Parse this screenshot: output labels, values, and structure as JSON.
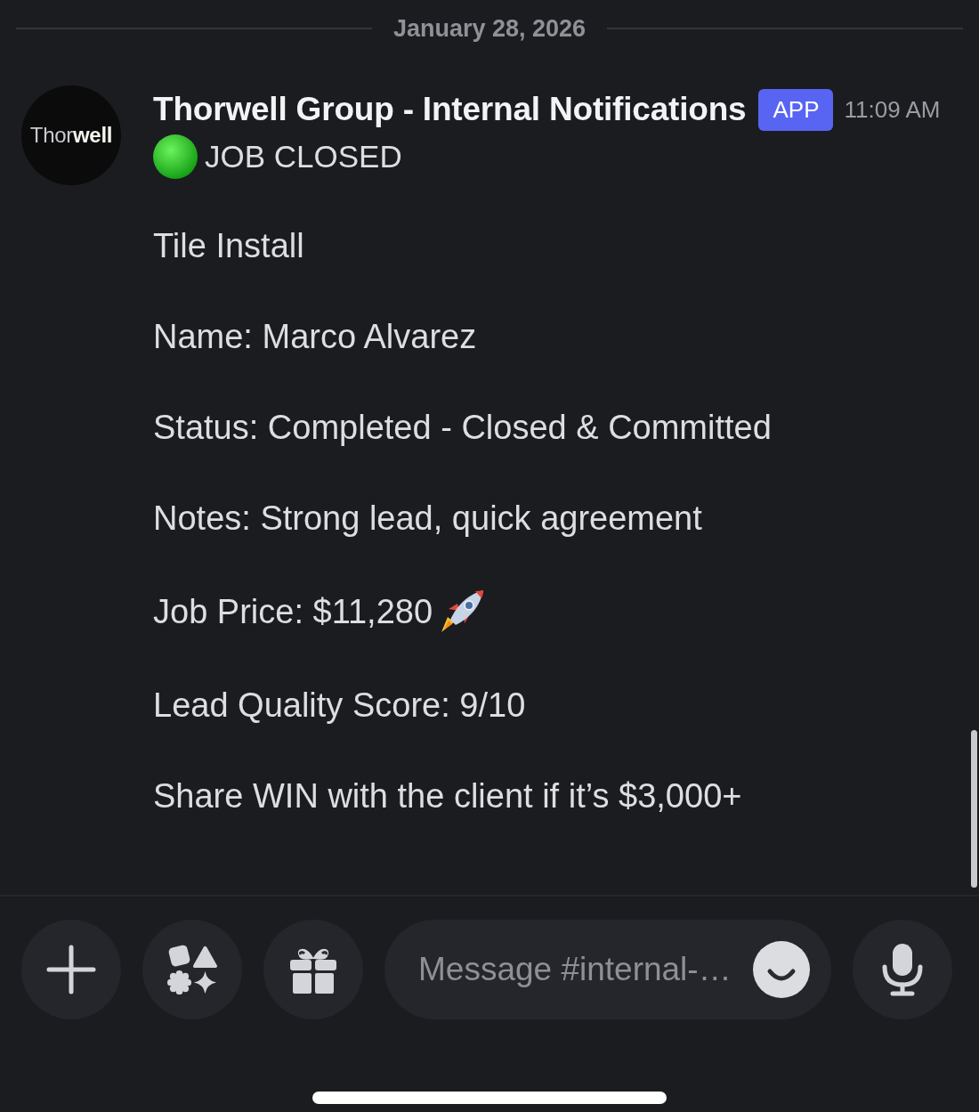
{
  "date_divider": "January 28, 2026",
  "message": {
    "avatar": {
      "logo": "Thor**well**"
    },
    "author": "Thorwell Group - Internal Notifications",
    "badge": "APP",
    "time": "11:09 AM",
    "headline": "JOB CLOSED",
    "paragraphs": [
      {
        "kind": "plain",
        "text": "Tile Install"
      },
      {
        "kind": "plain",
        "text": "Name: Marco Alvarez"
      },
      {
        "kind": "plain",
        "text": "Status: Completed - Closed & Committed"
      },
      {
        "kind": "plain",
        "text": "Notes: Strong lead, quick agreement"
      },
      {
        "kind": "rocket",
        "text": "Job Price: $11,280"
      },
      {
        "kind": "plain",
        "text": "Lead Quality Score: 9/10"
      },
      {
        "kind": "plain",
        "text": "Share WIN with the client if it’s $3,000+"
      }
    ]
  },
  "composer": {
    "placeholder": "Message #internal-…"
  }
}
